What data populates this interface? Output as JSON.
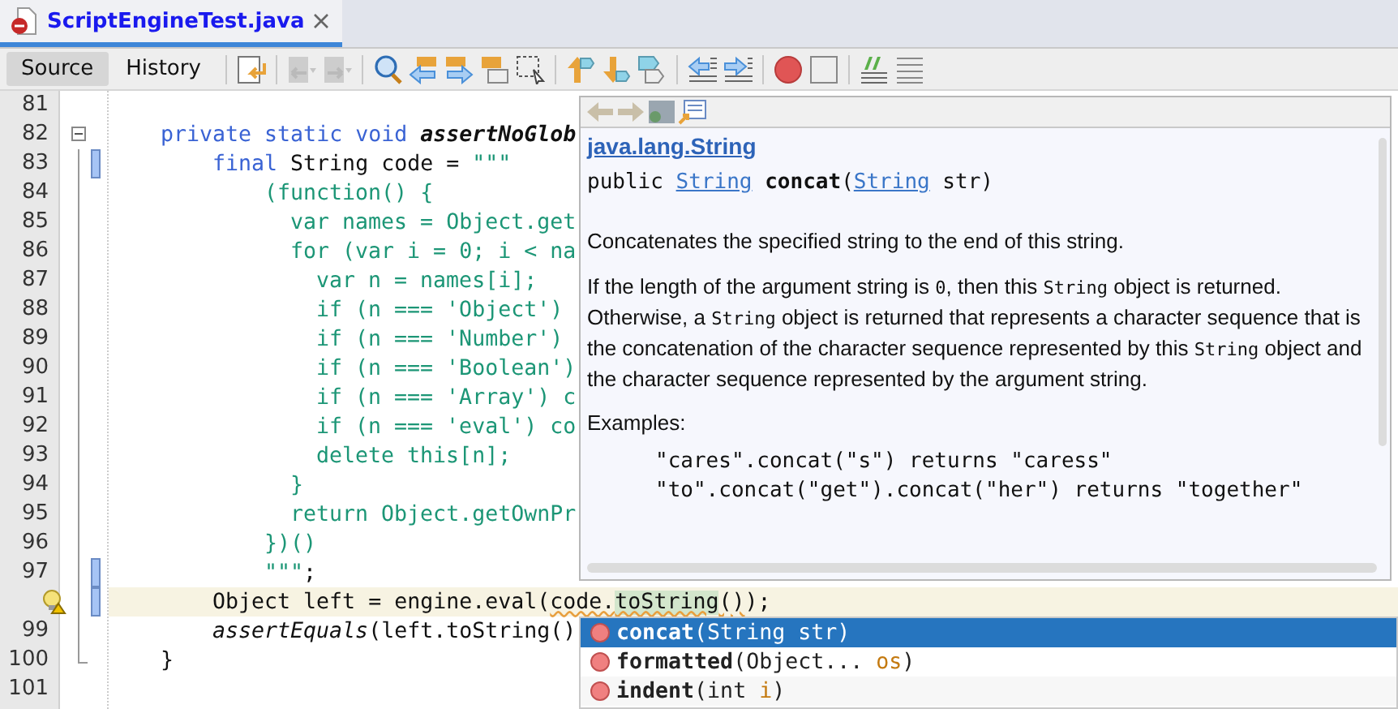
{
  "file_tab": {
    "title": "ScriptEngineTest.java",
    "selected": true
  },
  "view_tabs": [
    {
      "label": "Source",
      "selected": true
    },
    {
      "label": "History",
      "selected": false
    }
  ],
  "toolbar": [
    {
      "kind": "last-edit",
      "disabled": false
    },
    {
      "kind": "separator"
    },
    {
      "kind": "back",
      "disabled": true
    },
    {
      "kind": "forward",
      "disabled": true
    },
    {
      "kind": "separator"
    },
    {
      "kind": "find",
      "disabled": false
    },
    {
      "kind": "find-prev",
      "disabled": false
    },
    {
      "kind": "find-next",
      "disabled": false
    },
    {
      "kind": "find-selection",
      "disabled": false
    },
    {
      "kind": "rect-select",
      "disabled": false
    },
    {
      "kind": "separator"
    },
    {
      "kind": "prev-bookmark",
      "disabled": false
    },
    {
      "kind": "next-bookmark",
      "disabled": false
    },
    {
      "kind": "toggle-bookmark",
      "disabled": false
    },
    {
      "kind": "separator"
    },
    {
      "kind": "shift-left",
      "disabled": false
    },
    {
      "kind": "shift-right",
      "disabled": false
    },
    {
      "kind": "separator"
    },
    {
      "kind": "record",
      "disabled": false
    },
    {
      "kind": "stop",
      "disabled": false
    },
    {
      "kind": "separator"
    },
    {
      "kind": "comment",
      "disabled": false
    },
    {
      "kind": "uncomment",
      "disabled": false
    }
  ],
  "lines": [
    {
      "number": "81",
      "changed": false,
      "hint": false,
      "current": false
    },
    {
      "number": "82",
      "fold_toggle": {
        "expanded": true
      },
      "changed": false,
      "hint": false,
      "current": false,
      "segments": [
        {
          "text": "    private static void ",
          "kind": "keyword"
        },
        {
          "text": "assertNoGlob",
          "kind": "method"
        }
      ]
    },
    {
      "number": "83",
      "fold_end": false,
      "changed": true,
      "hint": false,
      "current": false,
      "segments": [
        {
          "text": "        final",
          "kind": "keyword"
        },
        {
          "text": " String code = ",
          "kind": "plain"
        },
        {
          "text": "\"\"\"",
          "kind": "string"
        }
      ]
    },
    {
      "number": "84",
      "fold_end": false,
      "changed": false,
      "hint": false,
      "current": false,
      "segments": [
        {
          "text": "            (function() {",
          "kind": "string"
        }
      ]
    },
    {
      "number": "85",
      "fold_end": false,
      "changed": false,
      "hint": false,
      "current": false,
      "segments": [
        {
          "text": "              var names = Object.get",
          "kind": "string"
        }
      ]
    },
    {
      "number": "86",
      "fold_end": false,
      "changed": false,
      "hint": false,
      "current": false,
      "segments": [
        {
          "text": "              for (var i = 0; i < na",
          "kind": "string"
        }
      ]
    },
    {
      "number": "87",
      "fold_end": false,
      "changed": false,
      "hint": false,
      "current": false,
      "segments": [
        {
          "text": "                var n = names[i];",
          "kind": "string"
        }
      ]
    },
    {
      "number": "88",
      "fold_end": false,
      "changed": false,
      "hint": false,
      "current": false,
      "segments": [
        {
          "text": "                if (n === 'Object')",
          "kind": "string"
        }
      ]
    },
    {
      "number": "89",
      "fold_end": false,
      "changed": false,
      "hint": false,
      "current": false,
      "segments": [
        {
          "text": "                if (n === 'Number')",
          "kind": "string"
        }
      ]
    },
    {
      "number": "90",
      "fold_end": false,
      "changed": false,
      "hint": false,
      "current": false,
      "segments": [
        {
          "text": "                if (n === 'Boolean')",
          "kind": "string"
        }
      ]
    },
    {
      "number": "91",
      "fold_end": false,
      "changed": false,
      "hint": false,
      "current": false,
      "segments": [
        {
          "text": "                if (n === 'Array') c",
          "kind": "string"
        }
      ]
    },
    {
      "number": "92",
      "fold_end": false,
      "changed": false,
      "hint": false,
      "current": false,
      "segments": [
        {
          "text": "                if (n === 'eval') co",
          "kind": "string"
        }
      ]
    },
    {
      "number": "93",
      "fold_end": false,
      "changed": false,
      "hint": false,
      "current": false,
      "segments": [
        {
          "text": "                delete this[n];",
          "kind": "string"
        }
      ]
    },
    {
      "number": "94",
      "fold_end": false,
      "changed": false,
      "hint": false,
      "current": false,
      "segments": [
        {
          "text": "              }",
          "kind": "string"
        }
      ]
    },
    {
      "number": "95",
      "fold_end": false,
      "changed": false,
      "hint": false,
      "current": false,
      "segments": [
        {
          "text": "              return Object.getOwnPr",
          "kind": "string"
        }
      ]
    },
    {
      "number": "96",
      "fold_end": false,
      "changed": false,
      "hint": false,
      "current": false,
      "segments": [
        {
          "text": "            })()",
          "kind": "string"
        }
      ]
    },
    {
      "number": "97",
      "fold_end": false,
      "changed": true,
      "hint": false,
      "current": false,
      "segments": [
        {
          "text": "            \"\"\"",
          "kind": "string"
        },
        {
          "text": ";",
          "kind": "plain"
        }
      ]
    },
    {
      "fold_end": false,
      "changed": true,
      "hint": true,
      "current": true,
      "segments": [
        {
          "text": "        Object left = engine.eval(",
          "kind": "plain"
        },
        {
          "text": "code.",
          "kind": "warning"
        },
        {
          "text": "toString",
          "kind": "occurrence"
        },
        {
          "text": "()",
          "kind": "warning"
        },
        {
          "text": ");",
          "kind": "plain"
        }
      ]
    },
    {
      "number": "99",
      "fold_end": false,
      "changed": false,
      "hint": false,
      "current": false,
      "segments": [
        {
          "text": "        assertEquals",
          "kind": "italic"
        },
        {
          "text": "(left.toString()",
          "kind": "plain"
        }
      ]
    },
    {
      "number": "100",
      "fold_end": true,
      "changed": false,
      "hint": false,
      "current": false,
      "segments": [
        {
          "text": "    }",
          "kind": "plain"
        }
      ]
    },
    {
      "number": "101",
      "changed": false,
      "hint": false,
      "current": false
    }
  ],
  "javadoc": {
    "class_link": "java.lang.String",
    "signature": [
      {
        "text": "public ",
        "kind": "plain"
      },
      {
        "text": "String",
        "kind": "link"
      },
      {
        "text": " concat",
        "kind": "bold"
      },
      {
        "text": "(",
        "kind": "plain"
      },
      {
        "text": "String",
        "kind": "link"
      },
      {
        "text": " str)",
        "kind": "plain"
      }
    ],
    "summary": "Concatenates the specified string to the end of this string.",
    "details": [
      {
        "text": "If the length of the argument string is ",
        "kind": "plain"
      },
      {
        "text": "0",
        "kind": "code"
      },
      {
        "text": ", then this ",
        "kind": "plain"
      },
      {
        "text": "String",
        "kind": "code"
      },
      {
        "text": " object is returned. Otherwise, a ",
        "kind": "plain"
      },
      {
        "text": "String",
        "kind": "code"
      },
      {
        "text": " object is returned that represents a character sequence that is the concatenation of the character sequence represented by this ",
        "kind": "plain"
      },
      {
        "text": "String",
        "kind": "code"
      },
      {
        "text": " object and the character sequence represented by the argument string.",
        "kind": "plain"
      }
    ],
    "examples_label": "Examples:",
    "examples": [
      "\"cares\".concat(\"s\") returns \"caress\"",
      "\"to\".concat(\"get\").concat(\"her\") returns \"together\""
    ]
  },
  "completions": [
    {
      "name": "concat",
      "args": [
        {
          "text": "(String ",
          "kind": "type"
        },
        {
          "text": "str",
          "kind": "param"
        },
        {
          "text": ")",
          "kind": "type"
        }
      ],
      "selected": true
    },
    {
      "name": "formatted",
      "args": [
        {
          "text": "(Object... ",
          "kind": "type"
        },
        {
          "text": "os",
          "kind": "param"
        },
        {
          "text": ")",
          "kind": "type"
        }
      ],
      "selected": false
    },
    {
      "name": "indent",
      "args": [
        {
          "text": "(int ",
          "kind": "type"
        },
        {
          "text": "i",
          "kind": "param"
        },
        {
          "text": ")",
          "kind": "type"
        }
      ],
      "selected": false
    }
  ]
}
